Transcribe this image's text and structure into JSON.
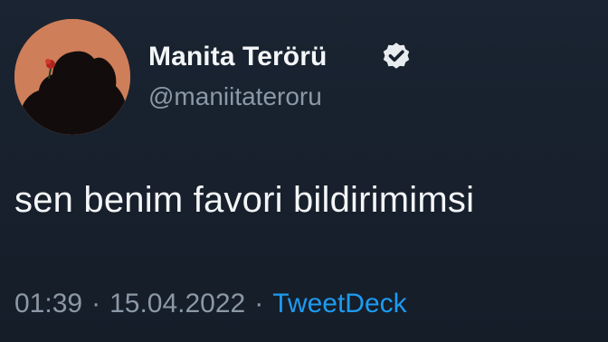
{
  "tweet": {
    "display_name": "Manita Terörü",
    "handle": "@maniitateroru",
    "text": "sen benim favori bildirimimsi",
    "time": "01:39",
    "date": "15.04.2022",
    "separator": "·",
    "source": "TweetDeck",
    "verified": true
  },
  "icons": {
    "avatar": "profile-photo",
    "verified": "verified-badge-icon"
  },
  "colors": {
    "background": "#15202b",
    "text_primary": "#f3f5f7",
    "text_secondary": "#8b98a5",
    "link": "#1d9bf0",
    "avatar_background": "#cf7e5a"
  }
}
